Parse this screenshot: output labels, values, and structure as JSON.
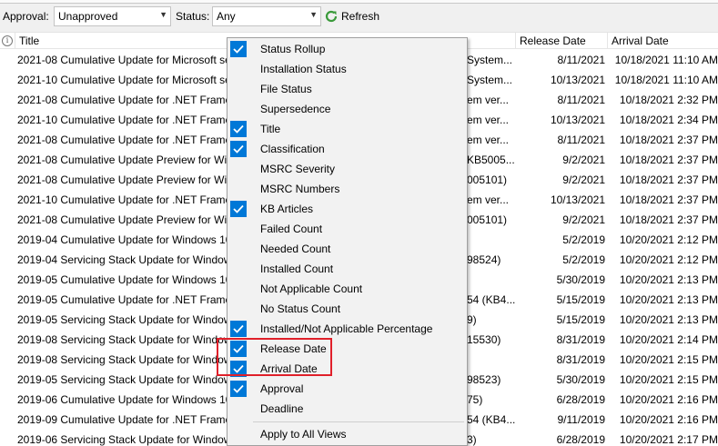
{
  "toolbar": {
    "approval_label": "Approval:",
    "approval_value": "Unapproved",
    "status_label": "Status:",
    "status_value": "Any",
    "refresh_label": "Refresh"
  },
  "columns": {
    "title": "Title",
    "release_date": "Release Date",
    "arrival_date": "Arrival Date"
  },
  "rows": [
    {
      "title": "2021-08 Cumulative Update for Microsoft se",
      "tail": "System...",
      "release": "8/11/2021",
      "arrival": "10/18/2021 11:10 AM"
    },
    {
      "title": "2021-10 Cumulative Update for Microsoft se",
      "tail": "System...",
      "release": "10/13/2021",
      "arrival": "10/18/2021 11:10 AM"
    },
    {
      "title": "2021-08 Cumulative Update for .NET Framew",
      "tail": "em ver...",
      "release": "8/11/2021",
      "arrival": "10/18/2021 2:32 PM"
    },
    {
      "title": "2021-10 Cumulative Update for .NET Framew",
      "tail": "em ver...",
      "release": "10/13/2021",
      "arrival": "10/18/2021 2:34 PM"
    },
    {
      "title": "2021-08 Cumulative Update for .NET Framew",
      "tail": "em ver...",
      "release": "8/11/2021",
      "arrival": "10/18/2021 2:37 PM"
    },
    {
      "title": "2021-08 Cumulative Update Preview for Win",
      "tail": "KB5005...",
      "release": "9/2/2021",
      "arrival": "10/18/2021 2:37 PM"
    },
    {
      "title": "2021-08 Cumulative Update Preview for Win",
      "tail": "005101)",
      "release": "9/2/2021",
      "arrival": "10/18/2021 2:37 PM"
    },
    {
      "title": "2021-10 Cumulative Update for .NET Framew",
      "tail": "em ver...",
      "release": "10/13/2021",
      "arrival": "10/18/2021 2:37 PM"
    },
    {
      "title": "2021-08 Cumulative Update Preview for Win",
      "tail": "005101)",
      "release": "9/2/2021",
      "arrival": "10/18/2021 2:37 PM"
    },
    {
      "title": "2019-04 Cumulative Update for Windows 10",
      "tail": "",
      "release": "5/2/2019",
      "arrival": "10/20/2021 2:12 PM"
    },
    {
      "title": "2019-04 Servicing Stack Update for Window",
      "tail": "98524)",
      "release": "5/2/2019",
      "arrival": "10/20/2021 2:12 PM"
    },
    {
      "title": "2019-05 Cumulative Update for Windows 10",
      "tail": "",
      "release": "5/30/2019",
      "arrival": "10/20/2021 2:13 PM"
    },
    {
      "title": "2019-05 Cumulative Update for .NET Framew",
      "tail": "54 (KB4...",
      "release": "5/15/2019",
      "arrival": "10/20/2021 2:13 PM"
    },
    {
      "title": "2019-05 Servicing Stack Update for Window",
      "tail": "9)",
      "release": "5/15/2019",
      "arrival": "10/20/2021 2:13 PM"
    },
    {
      "title": "2019-08 Servicing Stack Update for Window",
      "tail": "15530)",
      "release": "8/31/2019",
      "arrival": "10/20/2021 2:14 PM"
    },
    {
      "title": "2019-08 Servicing Stack Update for Window",
      "tail": "",
      "release": "8/31/2019",
      "arrival": "10/20/2021 2:15 PM"
    },
    {
      "title": "2019-05 Servicing Stack Update for Window",
      "tail": "98523)",
      "release": "5/30/2019",
      "arrival": "10/20/2021 2:15 PM"
    },
    {
      "title": "2019-06 Cumulative Update for Windows 10",
      "tail": "75)",
      "release": "6/28/2019",
      "arrival": "10/20/2021 2:16 PM"
    },
    {
      "title": "2019-09 Cumulative Update for .NET Framew",
      "tail": "54 (KB4...",
      "release": "9/11/2019",
      "arrival": "10/20/2021 2:16 PM"
    },
    {
      "title": "2019-06 Servicing Stack Update for Window",
      "tail": "3)",
      "release": "6/28/2019",
      "arrival": "10/20/2021 2:17 PM"
    }
  ],
  "menu": {
    "items": [
      {
        "label": "Status Rollup",
        "checked": true
      },
      {
        "label": "Installation Status",
        "checked": false
      },
      {
        "label": "File Status",
        "checked": false
      },
      {
        "label": "Supersedence",
        "checked": false
      },
      {
        "label": "Title",
        "checked": true
      },
      {
        "label": "Classification",
        "checked": true
      },
      {
        "label": "MSRC Severity",
        "checked": false
      },
      {
        "label": "MSRC Numbers",
        "checked": false
      },
      {
        "label": "KB Articles",
        "checked": true
      },
      {
        "label": "Failed Count",
        "checked": false
      },
      {
        "label": "Needed Count",
        "checked": false
      },
      {
        "label": "Installed Count",
        "checked": false
      },
      {
        "label": "Not Applicable Count",
        "checked": false
      },
      {
        "label": "No Status Count",
        "checked": false
      },
      {
        "label": "Installed/Not Applicable Percentage",
        "checked": true
      },
      {
        "label": "Release Date",
        "checked": true
      },
      {
        "label": "Arrival Date",
        "checked": true
      },
      {
        "label": "Approval",
        "checked": true
      },
      {
        "label": "Deadline",
        "checked": false
      }
    ],
    "footer_label": "Apply to All Views"
  },
  "colors": {
    "check_blue": "#0078d7",
    "highlight_red": "#e0202a",
    "refresh_green": "#3a9a3a"
  }
}
